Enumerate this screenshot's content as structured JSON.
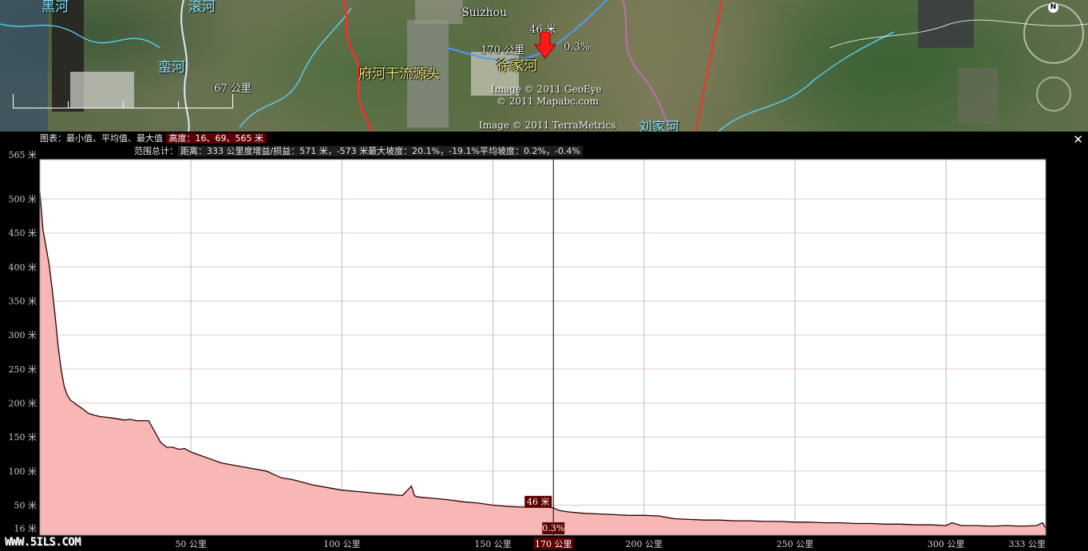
{
  "map": {
    "labels": [
      {
        "text": "黑河",
        "style": "cyan",
        "x": 52,
        "y": -6
      },
      {
        "text": "滚河",
        "style": "cyan",
        "x": 236,
        "y": -6
      },
      {
        "text": "蛮河",
        "style": "cyan",
        "x": 198,
        "y": 70
      },
      {
        "text": "府河干流源头",
        "style": "yellow",
        "x": 449,
        "y": 78
      },
      {
        "text": "徐家河",
        "style": "yellow",
        "x": 622,
        "y": 68
      },
      {
        "text": "刘家河",
        "style": "cyan",
        "x": 800,
        "y": 145
      },
      {
        "text": "Suizhou",
        "style": "white",
        "x": 578,
        "y": 8
      }
    ],
    "scale_label": "67 公里",
    "credits": [
      "Image © 2011 GeoEye",
      "© 2011 Mapabc.com",
      "Image © 2011 TerraMetrics"
    ],
    "marker": {
      "elevation": "46 米",
      "distance": "170 公里",
      "slope": "0.3%"
    },
    "compass_label": "N"
  },
  "panel": {
    "chart_legend": "图表：最小值、平均值、最大值",
    "elevation_summary": "高度：16、69、565 米",
    "range_prefix": "范围总计：",
    "range_summary": "距离：333 公里度增益/损益：571 米，-573 米最大坡度：20.1%，-19.1%平均坡度：0.2%，-0.4%",
    "close_label": "✕"
  },
  "chart_data": {
    "type": "area",
    "xlabel": "",
    "ylabel": "",
    "x_unit": "公里",
    "y_unit": "米",
    "xlim": [
      0,
      333
    ],
    "ylim": [
      0,
      565
    ],
    "x_ticks": [
      {
        "value": 50,
        "label": "50 公里"
      },
      {
        "value": 100,
        "label": "100 公里"
      },
      {
        "value": 150,
        "label": "150 公里"
      },
      {
        "value": 200,
        "label": "200 公里"
      },
      {
        "value": 250,
        "label": "250 公里"
      },
      {
        "value": 300,
        "label": "300 公里"
      },
      {
        "value": 333,
        "label": "333 公里"
      }
    ],
    "y_ticks": [
      {
        "value": 16,
        "label": "16 米"
      },
      {
        "value": 50,
        "label": "50 米"
      },
      {
        "value": 100,
        "label": "100 米"
      },
      {
        "value": 150,
        "label": "150 米"
      },
      {
        "value": 200,
        "label": "200 米"
      },
      {
        "value": 250,
        "label": "250 米"
      },
      {
        "value": 300,
        "label": "300 米"
      },
      {
        "value": 350,
        "label": "350 米"
      },
      {
        "value": 400,
        "label": "400 米"
      },
      {
        "value": 450,
        "label": "450 米"
      },
      {
        "value": 500,
        "label": "500 米"
      },
      {
        "value": 565,
        "label": "565 米"
      }
    ],
    "grid": true,
    "fill_color": "#f8b7b7",
    "line_color": "#2a0000",
    "cursor": {
      "x": 170,
      "x_label": "170 公里",
      "elevation_label": "46 米",
      "slope_label": "0.3%"
    },
    "series": [
      {
        "x": [
          0,
          1,
          2,
          3,
          4,
          5,
          6,
          7,
          8,
          9,
          10,
          12,
          14,
          16,
          18,
          20,
          24,
          28,
          30,
          32,
          36,
          38,
          40,
          42,
          44,
          46,
          48,
          50,
          55,
          60,
          65,
          70,
          75,
          80,
          83,
          85,
          90,
          95,
          100,
          105,
          110,
          115,
          120,
          123,
          124,
          125,
          130,
          135,
          140,
          145,
          150,
          155,
          160,
          165,
          168,
          170,
          172,
          175,
          180,
          185,
          190,
          195,
          200,
          205,
          210,
          215,
          220,
          225,
          230,
          235,
          240,
          245,
          250,
          255,
          260,
          265,
          270,
          275,
          280,
          285,
          290,
          295,
          300,
          302,
          305,
          310,
          315,
          320,
          325,
          330,
          332,
          333
        ],
        "y": [
          510,
          455,
          430,
          405,
          370,
          330,
          285,
          250,
          225,
          212,
          205,
          198,
          192,
          185,
          182,
          180,
          178,
          175,
          176,
          174,
          174,
          158,
          142,
          135,
          135,
          132,
          133,
          128,
          120,
          112,
          108,
          104,
          100,
          90,
          88,
          86,
          80,
          76,
          72,
          70,
          68,
          66,
          64,
          78,
          64,
          62,
          60,
          58,
          55,
          53,
          50,
          48,
          47,
          50,
          47,
          46,
          42,
          40,
          38,
          37,
          36,
          35,
          35,
          34,
          30,
          29,
          28,
          28,
          27,
          27,
          26,
          26,
          25,
          25,
          24,
          24,
          23,
          23,
          22,
          22,
          21,
          21,
          20,
          24,
          20,
          20,
          19,
          20,
          19,
          20,
          24,
          16
        ]
      }
    ]
  }
}
